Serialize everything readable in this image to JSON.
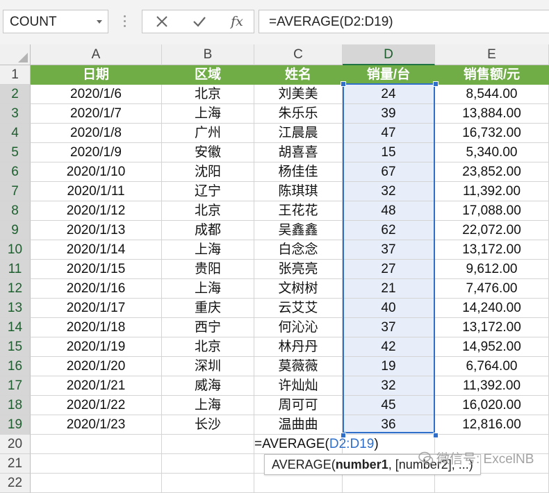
{
  "name_box": {
    "value": "COUNT"
  },
  "formula_bar": {
    "value": "=AVERAGE(D2:D19)"
  },
  "columns": [
    "A",
    "B",
    "C",
    "D",
    "E"
  ],
  "row_numbers": [
    "1",
    "2",
    "3",
    "4",
    "5",
    "6",
    "7",
    "8",
    "9",
    "10",
    "11",
    "12",
    "13",
    "14",
    "15",
    "16",
    "17",
    "18",
    "19",
    "20",
    "21",
    "22"
  ],
  "selected_column": "D",
  "header_row": [
    "日期",
    "区域",
    "姓名",
    "销量/台",
    "销售额/元"
  ],
  "rows": [
    [
      "2020/1/6",
      "北京",
      "刘美美",
      "24",
      "8,544.00"
    ],
    [
      "2020/1/7",
      "上海",
      "朱乐乐",
      "39",
      "13,884.00"
    ],
    [
      "2020/1/8",
      "广州",
      "江晨晨",
      "47",
      "16,732.00"
    ],
    [
      "2020/1/9",
      "安徽",
      "胡喜喜",
      "15",
      "5,340.00"
    ],
    [
      "2020/1/10",
      "沈阳",
      "杨佳佳",
      "67",
      "23,852.00"
    ],
    [
      "2020/1/11",
      "辽宁",
      "陈琪琪",
      "32",
      "11,392.00"
    ],
    [
      "2020/1/12",
      "北京",
      "王花花",
      "48",
      "17,088.00"
    ],
    [
      "2020/1/13",
      "成都",
      "吴鑫鑫",
      "62",
      "22,072.00"
    ],
    [
      "2020/1/14",
      "上海",
      "白念念",
      "37",
      "13,172.00"
    ],
    [
      "2020/1/15",
      "贵阳",
      "张亮亮",
      "27",
      "9,612.00"
    ],
    [
      "2020/1/16",
      "上海",
      "文树树",
      "21",
      "7,476.00"
    ],
    [
      "2020/1/17",
      "重庆",
      "云艾艾",
      "40",
      "14,240.00"
    ],
    [
      "2020/1/18",
      "西宁",
      "何沁沁",
      "37",
      "13,172.00"
    ],
    [
      "2020/1/19",
      "北京",
      "林丹丹",
      "42",
      "14,952.00"
    ],
    [
      "2020/1/20",
      "深圳",
      "莫薇薇",
      "19",
      "6,764.00"
    ],
    [
      "2020/1/21",
      "威海",
      "许灿灿",
      "32",
      "11,392.00"
    ],
    [
      "2020/1/22",
      "上海",
      "周可可",
      "45",
      "16,020.00"
    ],
    [
      "2020/1/23",
      "长沙",
      "温曲曲",
      "36",
      "12,816.00"
    ]
  ],
  "edit_cell": {
    "prefix": "=AVERAGE(",
    "range": "D2:D19",
    "suffix": ")"
  },
  "tooltip": {
    "func": "AVERAGE(",
    "arg1": "number1",
    "rest": ", [number2], ...)"
  },
  "watermark": {
    "text": "微信号: ExcelNB"
  },
  "colors": {
    "header_green": "#70ad47",
    "selection_blue": "#2f6ec9",
    "selection_fill": "#e7eef9"
  },
  "icons": {
    "cancel": "close-icon",
    "enter": "check-icon",
    "insert_function": "fx-icon"
  }
}
